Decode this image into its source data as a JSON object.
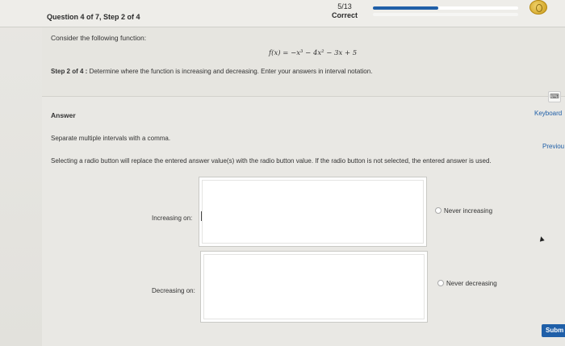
{
  "header": {
    "question_label": "Question 4 of 7, Step 2 of 4",
    "score_fraction": "5/13",
    "score_status": "Correct",
    "progress_fraction": 0.45
  },
  "problem": {
    "intro": "Consider the following function:",
    "formula": "f(x) = −x³ − 4x² − 3x + 5",
    "step_prefix": "Step 2 of 4 :",
    "step_text": " Determine where the function is increasing and decreasing. Enter your answers in interval notation."
  },
  "answer": {
    "heading": "Answer",
    "keyboard_icon": "keyboard-icon",
    "keyboard_label": "Keyboard",
    "hint": "Separate multiple intervals with a comma.",
    "previous_label": "Previou",
    "radio_note": "Selecting a radio button will replace the entered answer value(s) with the radio button value. If the radio button is not selected, the entered answer is used.",
    "increasing": {
      "label": "Increasing on:",
      "value": "",
      "radio_label": "Never increasing"
    },
    "decreasing": {
      "label": "Decreasing on:",
      "value": "",
      "radio_label": "Never decreasing"
    },
    "submit_label": "Subm"
  },
  "colors": {
    "accent": "#1f5fa8",
    "background": "#e6e5e0"
  }
}
